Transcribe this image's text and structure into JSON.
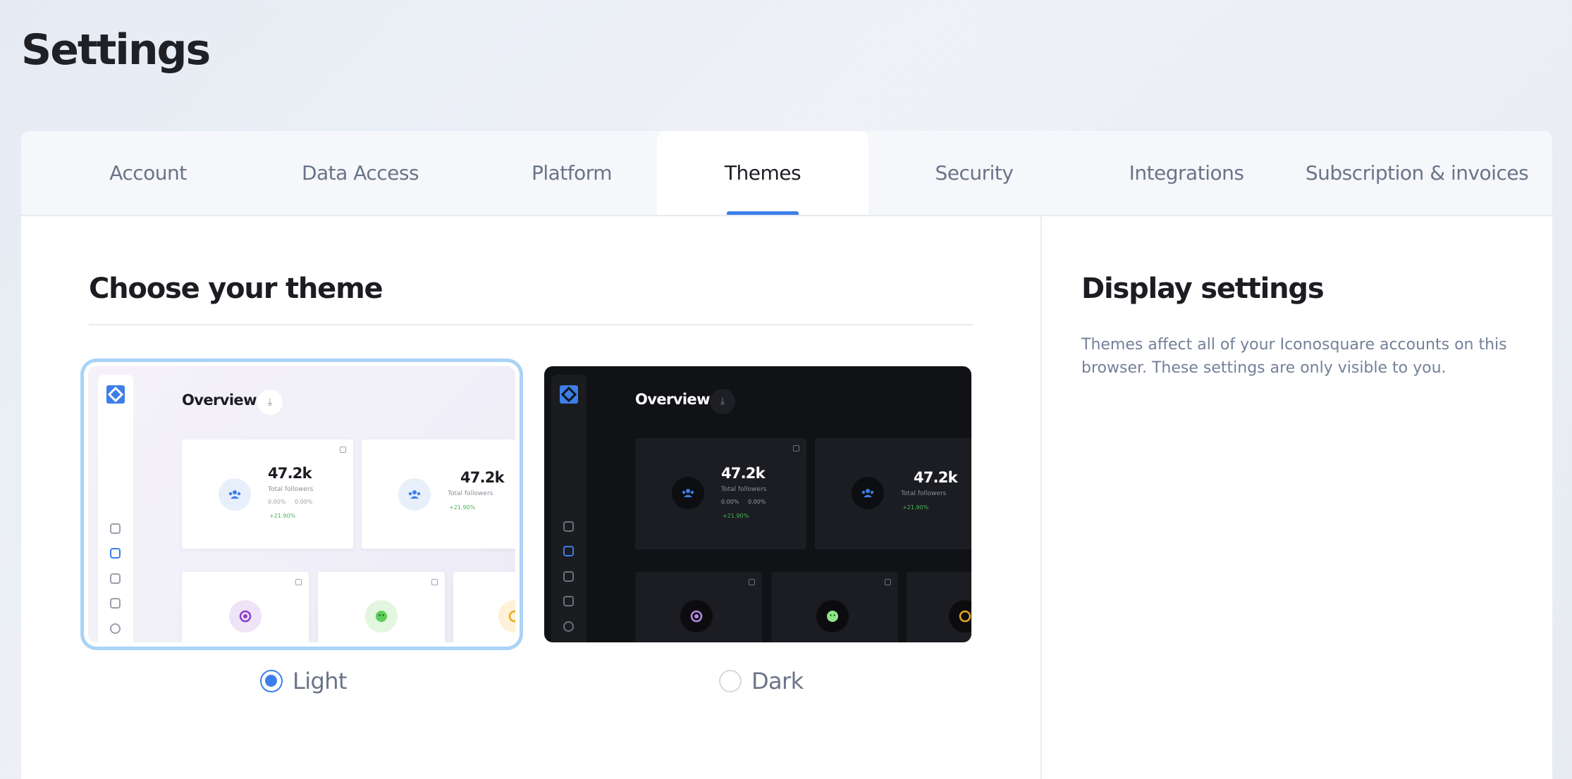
{
  "page": {
    "title": "Settings"
  },
  "tabs": [
    {
      "label": "Account",
      "active": false
    },
    {
      "label": "Data Access",
      "active": false
    },
    {
      "label": "Platform",
      "active": false
    },
    {
      "label": "Themes",
      "active": true
    },
    {
      "label": "Security",
      "active": false
    },
    {
      "label": "Integrations",
      "active": false
    },
    {
      "label": "Subscription & invoices",
      "active": false
    }
  ],
  "themes_section": {
    "title": "Choose your theme",
    "options": [
      {
        "label": "Light",
        "selected": true
      },
      {
        "label": "Dark",
        "selected": false
      }
    ],
    "preview": {
      "title": "Overview",
      "stat_value": "47.2k",
      "stat_label": "Total followers",
      "mini_a": "0.00%",
      "mini_b": "0.00%",
      "growth": "+21.90%"
    }
  },
  "display_settings": {
    "title": "Display settings",
    "description": "Themes affect all of your Iconosquare accounts on this browser. These settings are only visible to you."
  },
  "colors": {
    "accent": "#3d7ee8",
    "selected_outline": "#a9d3f7",
    "dark_card_bg": "#111215",
    "positive": "#45b75a"
  }
}
